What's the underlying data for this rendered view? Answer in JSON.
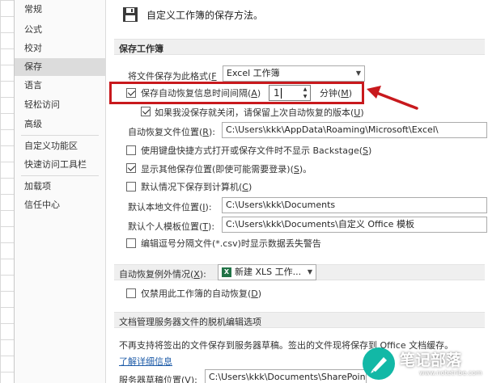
{
  "nav": {
    "items": [
      {
        "label": "常规"
      },
      {
        "label": "公式"
      },
      {
        "label": "校对"
      },
      {
        "label": "保存",
        "active": true
      },
      {
        "label": "语言"
      },
      {
        "label": "轻松访问"
      },
      {
        "label": "高级"
      },
      {
        "label": "自定义功能区"
      },
      {
        "label": "快速访问工具栏"
      },
      {
        "label": "加载项"
      },
      {
        "label": "信任中心"
      }
    ]
  },
  "header": {
    "icon": "save-floppy-icon",
    "text": "自定义工作簿的保存方法。"
  },
  "save_section": {
    "title": "保存工作簿",
    "format_label": "将文件保存为此格式(",
    "format_key": "F",
    "format_label_end": "):",
    "format_value": "Excel 工作簿",
    "autorecover_label": "保存自动恢复信息时间间隔(",
    "autorecover_key": "A",
    "autorecover_end": ")",
    "autorecover_checked": true,
    "autorecover_minutes": "1",
    "minutes_label": "分钟(",
    "minutes_key": "M",
    "minutes_end": ")",
    "keep_last_label": "如果我没保存就关闭，请保留上次自动恢复的版本(",
    "keep_last_key": "U",
    "keep_last_end": ")",
    "keep_last_checked": true,
    "ar_location_label": "自动恢复文件位置(",
    "ar_location_key": "R",
    "ar_location_end": "):",
    "ar_location_value": "C:\\Users\\kkk\\AppData\\Roaming\\Microsoft\\Excel\\",
    "no_backstage_label": "使用键盘快捷方式打开或保存文件时不显示 Backstage(",
    "no_backstage_key": "S",
    "no_backstage_end": ")",
    "no_backstage_checked": false,
    "show_other_label": "显示其他保存位置(即使可能需要登录)(",
    "show_other_key": "S",
    "show_other_end": ")。",
    "show_other_checked": true,
    "default_computer_label": "默认情况下保存到计算机(",
    "default_computer_key": "C",
    "default_computer_end": ")",
    "default_computer_checked": false,
    "local_location_label": "默认本地文件位置(",
    "local_location_key": "I",
    "local_location_end": "):",
    "local_location_value": "C:\\Users\\kkk\\Documents",
    "template_location_label": "默认个人模板位置(",
    "template_location_key": "T",
    "template_location_end": "):",
    "template_location_value": "C:\\Users\\kkk\\Documents\\自定义 Office 模板",
    "csv_warning_label": "编辑逗号分隔文件(*.csv)时显示数据丢失警告",
    "csv_warning_checked": false
  },
  "exceptions_section": {
    "title": "自动恢复例外情况(",
    "title_key": "X",
    "title_end": "):",
    "workbook_value": "新建 XLS 工作...",
    "disable_label": "仅禁用此工作簿的自动恢复(",
    "disable_key": "D",
    "disable_end": ")",
    "disable_checked": false
  },
  "offline_section": {
    "title": "文档管理服务器文件的脱机编辑选项",
    "description": "不再支持将签出的文件保存到服务器草稿。签出的文件现将保存到 Office 文档缓存。",
    "learn_more": "了解详细信息",
    "drafts_label": "服务器草稿位置(",
    "drafts_key": "V",
    "drafts_end": "):",
    "drafts_value": "C:\\Users\\kkk\\Documents\\SharePoint"
  },
  "watermark": {
    "text": "笔记部落",
    "url": "www.notetribe.com"
  },
  "colors": {
    "highlight": "#c8191d",
    "brand_teal": "#12b8a6",
    "link": "#1f5ca8",
    "excel_green": "#217346"
  }
}
